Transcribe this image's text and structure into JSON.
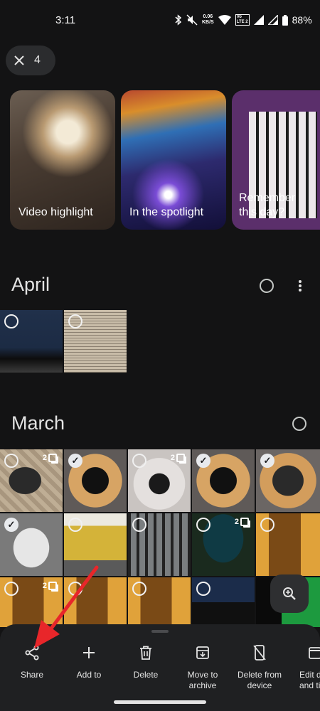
{
  "status_bar": {
    "time": "3:11",
    "speed_value": "0.06",
    "speed_unit": "KB/S",
    "network_top": "Vo",
    "network_bottom": "LTE 2",
    "battery": "88%"
  },
  "selection": {
    "count": "4"
  },
  "memories": [
    {
      "label": "Video highlight"
    },
    {
      "label": "In the spotlight"
    },
    {
      "label": "Remember this day?"
    }
  ],
  "sections": [
    {
      "title": "April"
    },
    {
      "title": "March"
    }
  ],
  "photos": {
    "april": [
      {
        "selected": false,
        "burst": ""
      },
      {
        "selected": false,
        "burst": ""
      }
    ],
    "march": [
      {
        "selected": false,
        "burst": "2"
      },
      {
        "selected": true,
        "burst": ""
      },
      {
        "selected": false,
        "burst": "2"
      },
      {
        "selected": true,
        "burst": ""
      },
      {
        "selected": true,
        "burst": ""
      },
      {
        "selected": true,
        "burst": ""
      },
      {
        "selected": false,
        "burst": ""
      },
      {
        "selected": false,
        "burst": ""
      },
      {
        "selected": false,
        "burst": "2"
      },
      {
        "selected": false,
        "burst": ""
      },
      {
        "selected": false,
        "burst": "2"
      },
      {
        "selected": false,
        "burst": ""
      },
      {
        "selected": false,
        "burst": ""
      },
      {
        "selected": false,
        "burst": ""
      },
      {
        "selected": false,
        "burst": ""
      }
    ]
  },
  "actions": [
    {
      "label": "Share",
      "icon": "share-icon"
    },
    {
      "label": "Add to",
      "icon": "plus-icon"
    },
    {
      "label": "Delete",
      "icon": "trash-icon"
    },
    {
      "label": "Move to archive",
      "icon": "archive-icon"
    },
    {
      "label": "Delete from device",
      "icon": "phone-off-icon"
    },
    {
      "label": "Edit d and ti",
      "icon": "calendar-icon"
    }
  ],
  "colors": {
    "background": "#131314",
    "sheet": "#1f2022",
    "annotation_arrow": "#e8262a"
  }
}
